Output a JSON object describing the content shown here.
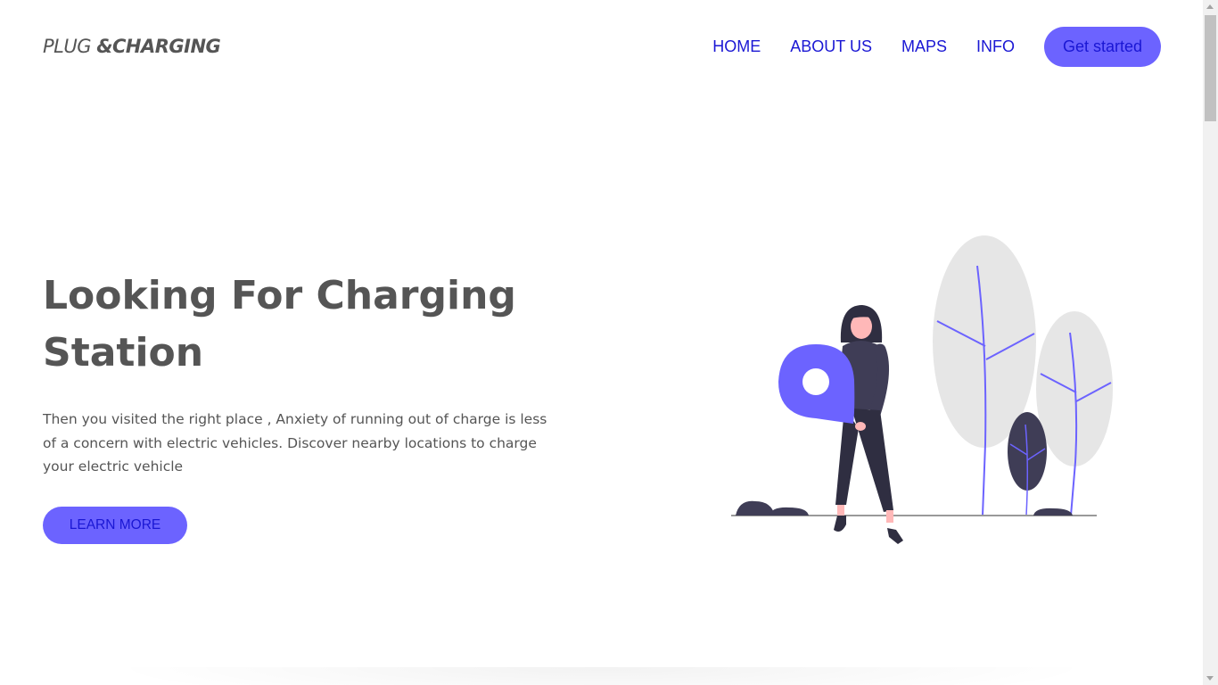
{
  "header": {
    "logo_light": "PLUG ",
    "logo_bold": "&CHARGING",
    "nav": [
      {
        "label": "HOME"
      },
      {
        "label": "ABOUT US"
      },
      {
        "label": "MAPS"
      },
      {
        "label": "INFO"
      }
    ],
    "cta_label": "Get started"
  },
  "hero": {
    "title": "Looking For Charging Station",
    "description": "Then you visited the right place , Anxiety of running out of charge is less of a concern with electric vehicles. Discover nearby locations to charge your electric vehicle",
    "button_label": "LEARN MORE",
    "illustration": "woman-holding-location-pin-illustration"
  },
  "colors": {
    "accent": "#6c63ff",
    "link": "#1a17d4",
    "text": "#555555",
    "dark": "#2f2e41",
    "foliage": "#e6e6e6"
  }
}
